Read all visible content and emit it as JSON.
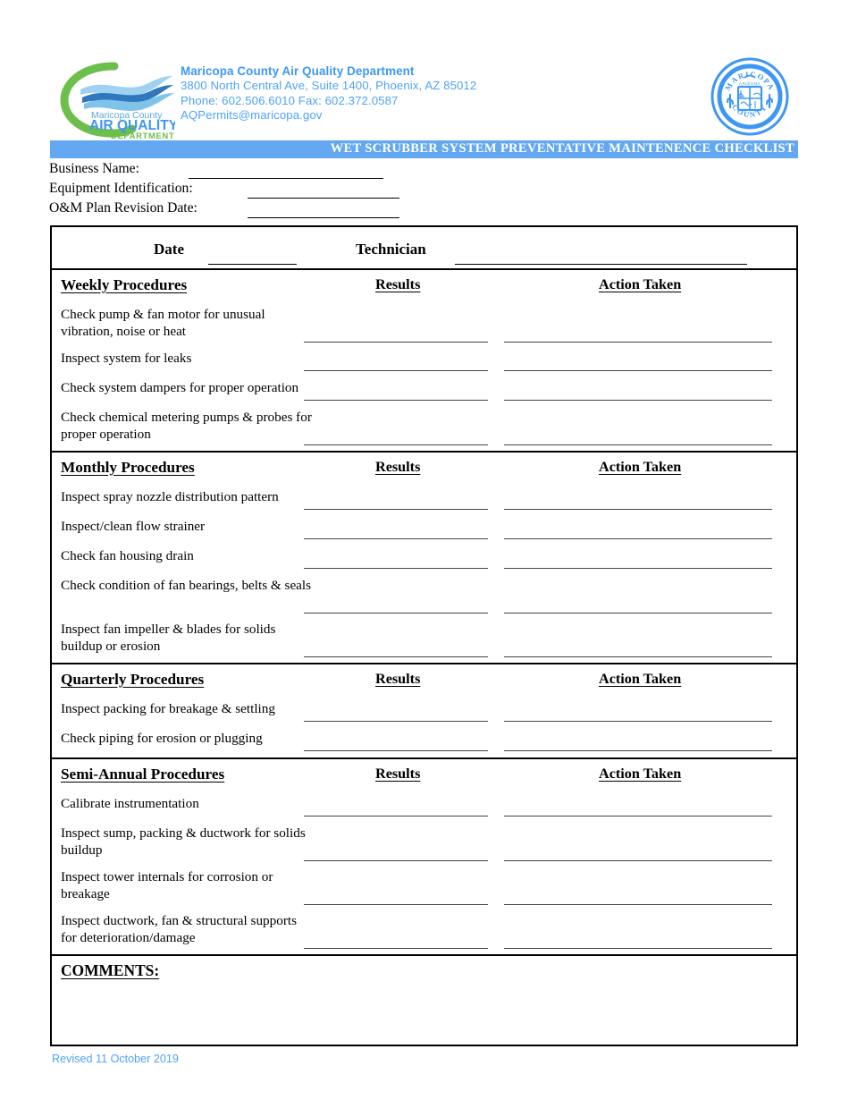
{
  "letterhead": {
    "logo_alt": "Maricopa County Air Quality Department",
    "logo_line1": "Maricopa County",
    "logo_line2": "AIR QUALITY",
    "logo_line3": "DEPARTMENT",
    "department_name": "Maricopa County Air Quality Department",
    "address": "3800 North Central Ave, Suite 1400, Phoenix, AZ 85012",
    "phone_fax": "Phone: 602.506.6010  Fax: 602.372.0587",
    "email": "AQPermits@maricopa.gov",
    "seal_top_text": "MARICOPA",
    "seal_bottom_text": "COUNTY",
    "seal_inner_text": "ARIZONA",
    "accent_blue": "#4fa3f7",
    "logo_green": "#6cbf4b"
  },
  "form": {
    "title": "WET SCRUBBER SYSTEM PREVENTATIVE MAINTENENCE CHECKLIST",
    "title_banner_color": "#63a8f0"
  },
  "identification": {
    "business_name_label": "Business Name:",
    "business_name_value": "",
    "equipment_id_label": "Equipment Identification:",
    "equipment_id_value": "",
    "om_plan_revision_label": "O&M Plan Revision Date:",
    "om_plan_revision_value": ""
  },
  "header_row": {
    "date_label": "Date",
    "date_value": "",
    "technician_label": "Technician",
    "technician_value": ""
  },
  "columns": {
    "results": "Results",
    "action_taken": "Action Taken"
  },
  "sections": [
    {
      "title": "Weekly Procedures",
      "procedures": [
        {
          "text": "Check pump & fan motor for unusual vibration, noise or heat",
          "lines": 2,
          "results": "",
          "action": ""
        },
        {
          "text": "Inspect system for leaks",
          "lines": 1,
          "results": "",
          "action": ""
        },
        {
          "text": "Check system dampers for proper operation",
          "lines": 1,
          "results": "",
          "action": ""
        },
        {
          "text": "Check chemical metering pumps & probes for proper operation",
          "lines": 2,
          "results": "",
          "action": ""
        }
      ]
    },
    {
      "title": "Monthly Procedures",
      "procedures": [
        {
          "text": "Inspect spray nozzle distribution pattern",
          "lines": 1,
          "results": "",
          "action": ""
        },
        {
          "text": "Inspect/clean flow strainer",
          "lines": 1,
          "results": "",
          "action": ""
        },
        {
          "text": "Check fan housing drain",
          "lines": 1,
          "results": "",
          "action": ""
        },
        {
          "text": "Check condition of fan bearings, belts & seals",
          "lines": 2,
          "results": "",
          "action": ""
        },
        {
          "text": "Inspect fan impeller & blades for solids buildup or erosion",
          "lines": 2,
          "results": "",
          "action": ""
        }
      ]
    },
    {
      "title": "Quarterly Procedures",
      "procedures": [
        {
          "text": "Inspect packing for breakage & settling",
          "lines": 1,
          "results": "",
          "action": ""
        },
        {
          "text": "Check piping for erosion or plugging",
          "lines": 1,
          "results": "",
          "action": ""
        }
      ]
    },
    {
      "title": "Semi-Annual Procedures",
      "procedures": [
        {
          "text": "Calibrate instrumentation",
          "lines": 1,
          "results": "",
          "action": ""
        },
        {
          "text": "Inspect sump, packing & ductwork for solids buildup",
          "lines": 2,
          "results": "",
          "action": ""
        },
        {
          "text": "Inspect tower internals for corrosion or breakage",
          "lines": 2,
          "results": "",
          "action": ""
        },
        {
          "text": "Inspect ductwork, fan & structural supports for deterioration/damage",
          "lines": 2,
          "results": "",
          "action": ""
        }
      ]
    }
  ],
  "comments": {
    "label": "COMMENTS:",
    "value": ""
  },
  "footer": {
    "revision_note": "Revised 11 October 2019"
  }
}
